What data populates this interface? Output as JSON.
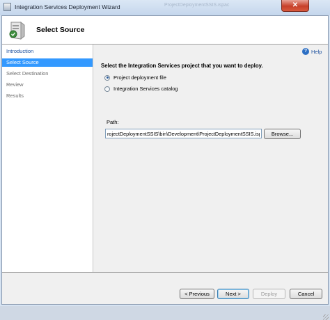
{
  "window": {
    "title": "Integration Services Deployment Wizard",
    "background_tab_hint": "ProjectDeploymentSSIS.ispac",
    "close_glyph": "✕"
  },
  "header": {
    "title": "Select Source"
  },
  "nav": {
    "items": [
      {
        "label": "Introduction",
        "state": "link"
      },
      {
        "label": "Select Source",
        "state": "selected"
      },
      {
        "label": "Select Destination",
        "state": "disabled"
      },
      {
        "label": "Review",
        "state": "disabled"
      },
      {
        "label": "Results",
        "state": "disabled"
      }
    ]
  },
  "help": {
    "label": "Help",
    "icon": "help-icon",
    "glyph": "?"
  },
  "main": {
    "instruction": "Select the Integration Services project that you want to deploy.",
    "options": [
      {
        "label": "Project deployment file",
        "selected": true
      },
      {
        "label": "Integration Services catalog",
        "selected": false
      }
    ],
    "path_label": "Path:",
    "path_value": "rojectDeploymentSSIS\\bin\\Development\\ProjectDeploymentSSIS.ispac",
    "browse_label": "Browse..."
  },
  "footer": {
    "previous_label": "< Previous",
    "next_label": "Next >",
    "deploy_label": "Deploy",
    "cancel_label": "Cancel"
  },
  "colors": {
    "selection": "#3399ff",
    "link": "#1a4f9e",
    "close_button": "#c7402a"
  }
}
